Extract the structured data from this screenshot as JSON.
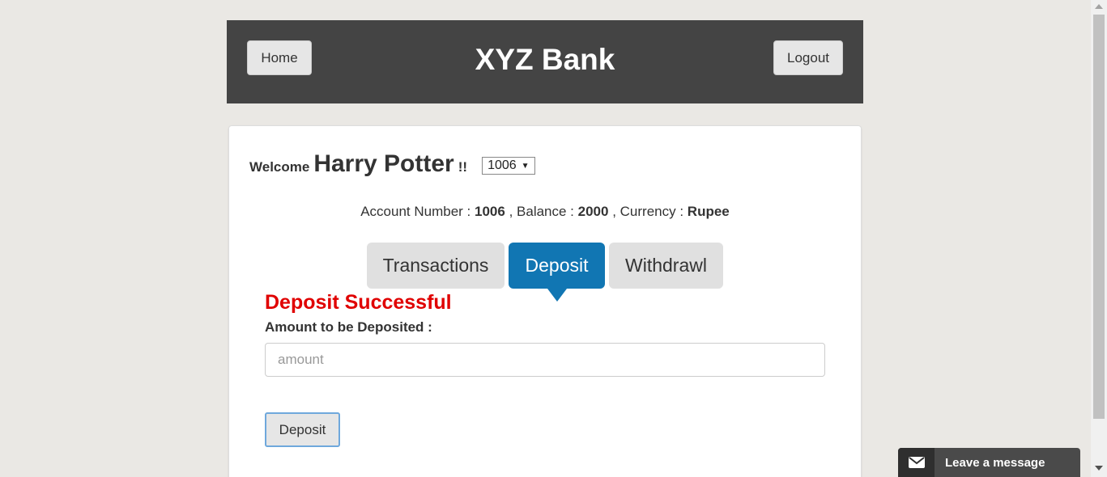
{
  "header": {
    "title": "XYZ Bank",
    "home_label": "Home",
    "logout_label": "Logout"
  },
  "welcome": {
    "prefix": "Welcome",
    "user_name": "Harry Potter",
    "suffix": "!!",
    "selected_account": "1006"
  },
  "account_info": {
    "account_number_label": "Account Number :",
    "account_number": "1006",
    "balance_label": ", Balance :",
    "balance": "2000",
    "currency_label": ", Currency :",
    "currency": "Rupee"
  },
  "tabs": [
    {
      "label": "Transactions",
      "active": false
    },
    {
      "label": "Deposit",
      "active": true
    },
    {
      "label": "Withdrawl",
      "active": false
    }
  ],
  "deposit_form": {
    "status_message": "Deposit Successful",
    "amount_label": "Amount to be Deposited :",
    "amount_placeholder": "amount",
    "amount_value": "",
    "submit_label": "Deposit"
  },
  "chat_widget": {
    "label": "Leave a message",
    "icon": "envelope-icon"
  },
  "colors": {
    "page_bg": "#eae8e4",
    "header_bg": "#444444",
    "active_tab": "#1176b3",
    "success_text": "#e00000"
  }
}
